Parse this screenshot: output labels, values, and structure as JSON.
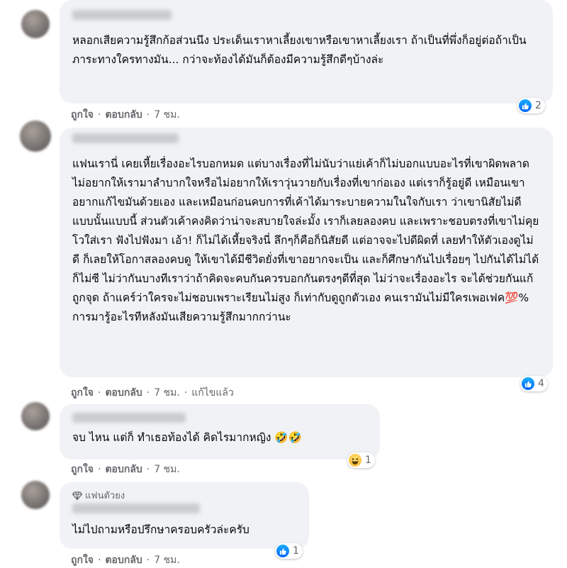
{
  "comments": [
    {
      "text": "หลอกเสียความรู้สึกก้อส่วนนึง ประเด็นเราหาเลี้ยงเขาหรือเขาหาเลี้ยงเรา ถ้าเป็นที่พึ่งก็อยู่ต่อถ้าเป็นภาระทางใครทางมัน... กว่าจะท้องได้มันก็ต้องมีความรู้สึกดีๆบ้างล่ะ",
      "like_label": "ถูกใจ",
      "reply_label": "ตอบกลับ",
      "time": "7 ชม.",
      "reaction": {
        "type": "like",
        "count": "2"
      }
    },
    {
      "text": "แฟนเรานี่ เคยเหี้ยเรื่องอะไรบอกหมด แต่บางเรื่องที่ไม่นับว่าแย่เค้าก็ไม่บอกแบบอะไรที่เขาผิดพลาด ไม่อยากให้เรามาลำบากใจหรือไม่อยากให้เราวุ่นวายกับเรื่องที่เขาก่อเอง แต่เราก็รู้อยู่ดี เหมือนเขาอยากแก้ไขมันด้วยเอง และเหมือนก่อนคบการที่เค้าได้มาระบายความในใจกับเรา ว่าเขานิสัยไม่ดีแบบนั้นแบบนี้ ส่วนตัวเค้าคงคิดว่าน่าจะสบายใจล่ะมั้ง เราก็เลยลองคบ และเพราะชอบตรงที่เขาไม่คุยโวใส่เรา ฟังไปฟังมา เอ้า! ก็ไม่ได้เหี้ยจริงนี่ ลึกๆก็คือก็นิสัยดี แต่อาจจะไปดีผิดที่ เลยทำให้ตัวเองดูไม่ดี ก็เลยให้โอกาสลองคบดู ให้เขาได้มีชีวิตยั่งที่เขาอยากจะเป็น และก็ศึกษากันไปเรื่อยๆ ไปกันได้ไม่ได้ก็ไม่ซี ไม่ว่ากันบางทีเราว่าถ้าคิดจะคบกันควรบอกกันตรงๆดีที่สุด ไม่ว่าจะเรื่องอะไร จะได้ช่วยกันแก้ถูกจุด ถ้าแคร์ว่าใครจะไม่ชอบเพราะเรียนไม่สูง ก็เท่ากับดูถูกตัวเอง คนเรามันไม่มีใครเพอเฟค💯% การมารู้อะไรทีหลังมันเสียความรู้สึกมากกว่านะ",
      "like_label": "ถูกใจ",
      "reply_label": "ตอบกลับ",
      "time": "7 ชม.",
      "edited_label": "แก้ไขแล้ว",
      "reaction": {
        "type": "like",
        "count": "4"
      }
    },
    {
      "text": "จบ ไหน แต่ก็ ทำเธอท้องได้ คิดไรมากหญิง 🤣🤣",
      "like_label": "ถูกใจ",
      "reply_label": "ตอบกลับ",
      "time": "7 ชม.",
      "reaction": {
        "type": "haha",
        "count": "1"
      }
    },
    {
      "badge": "แฟนตัวยง",
      "text": "ไม่ไปถามหรือปรึกษาครอบครัวล่ะครับ",
      "like_label": "ถูกใจ",
      "reply_label": "ตอบกลับ",
      "time": "7 ชม.",
      "reaction": {
        "type": "like",
        "count": "1"
      }
    }
  ],
  "colors": {
    "bubble": "#f0f2f5",
    "meta": "#65676b",
    "like": "#0866ff",
    "haha": "#f7b125"
  },
  "icons": [
    "like-icon",
    "haha-icon",
    "diamond-icon"
  ]
}
